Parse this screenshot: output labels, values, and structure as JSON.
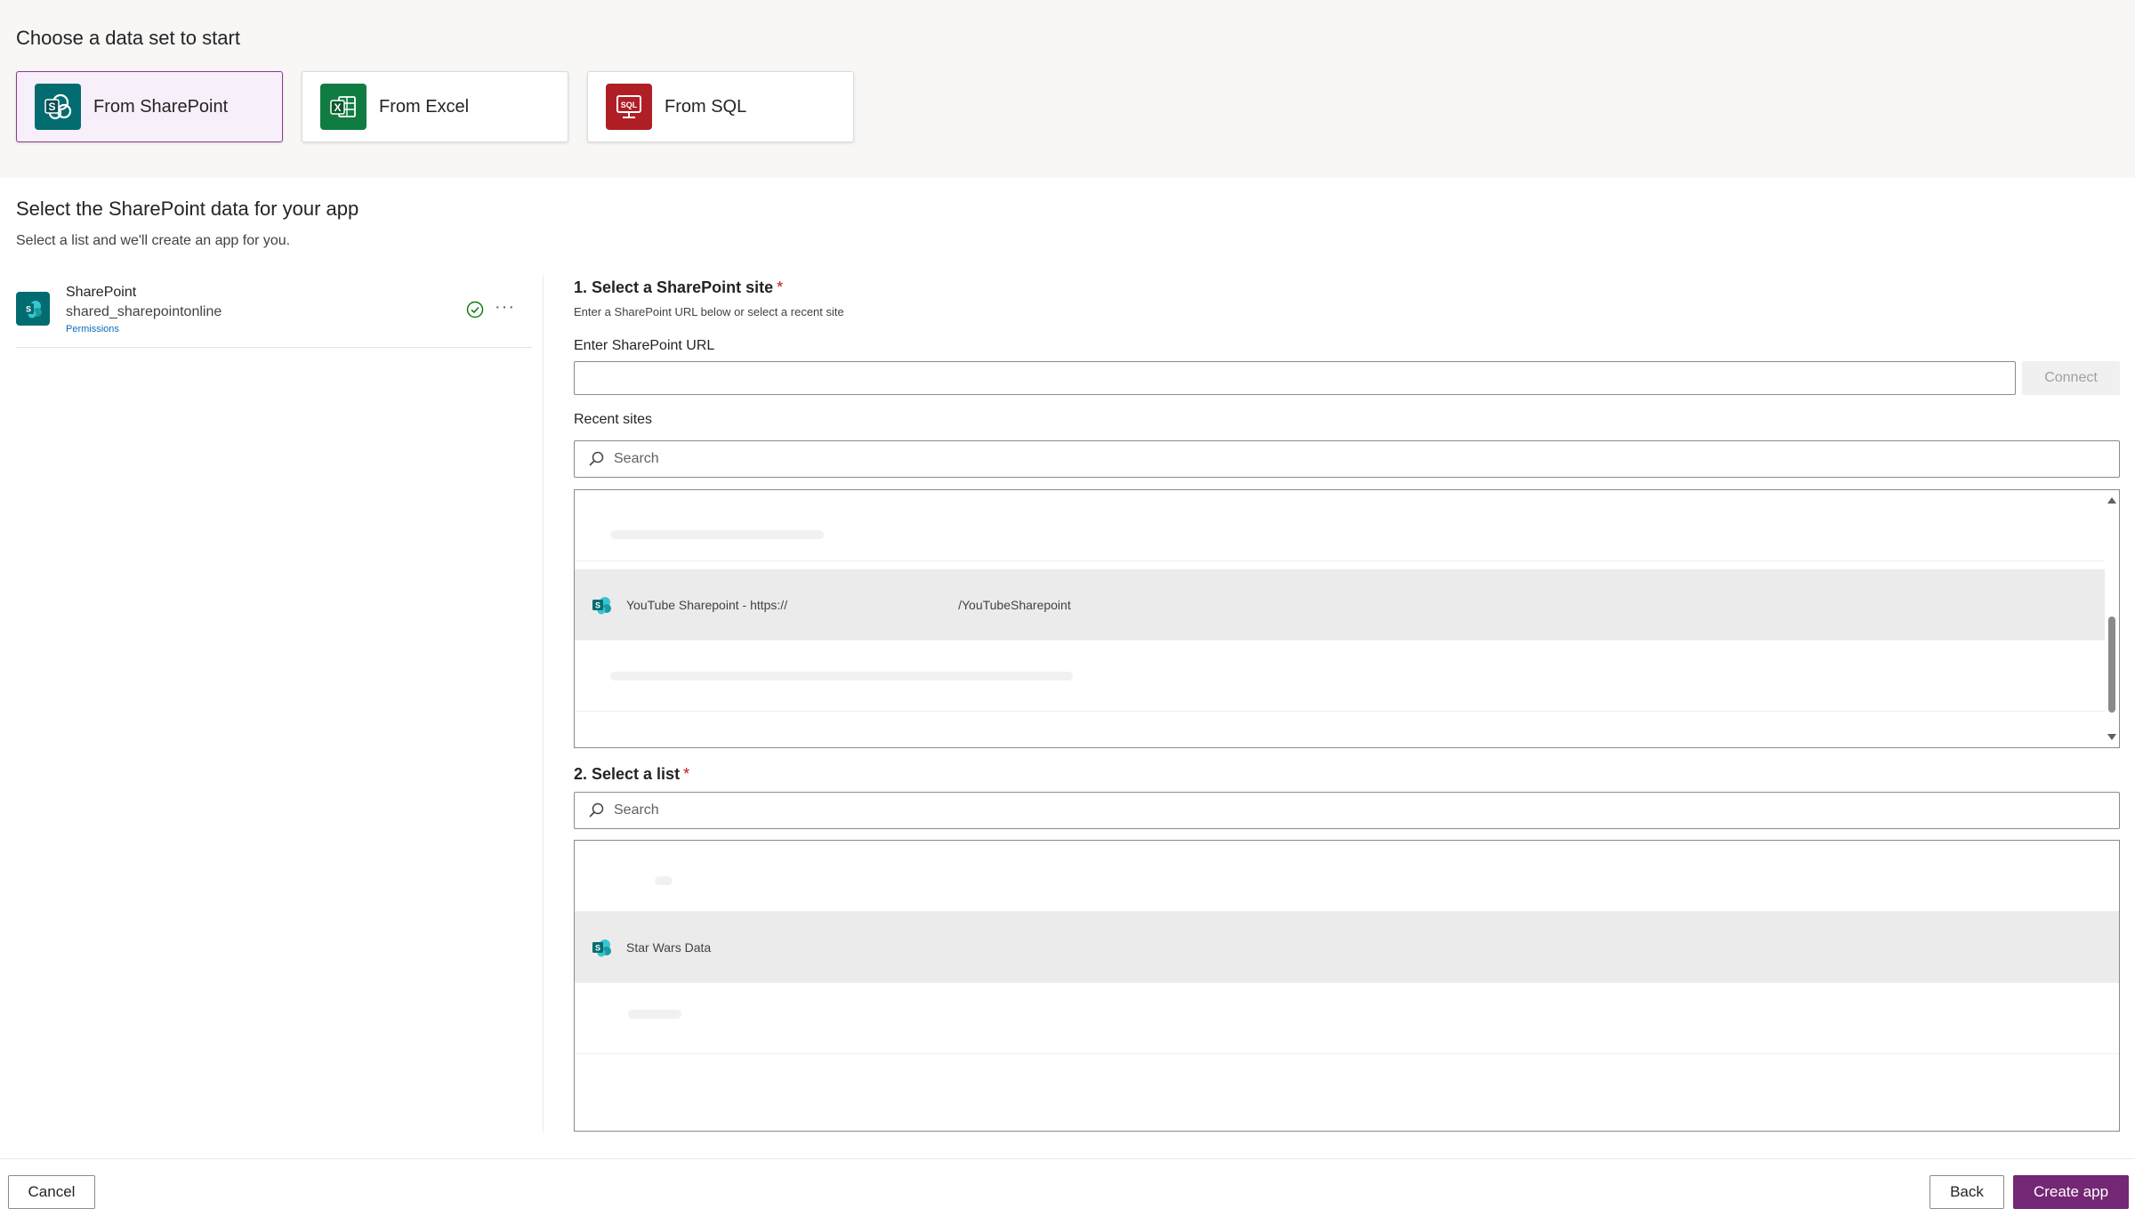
{
  "header": {
    "title": "Choose a data set to start"
  },
  "sources": [
    {
      "label": "From SharePoint",
      "icon": "sharepoint-icon",
      "color": "#036c70",
      "selected": true
    },
    {
      "label": "From Excel",
      "icon": "excel-icon",
      "color": "#107c41",
      "selected": false
    },
    {
      "label": "From SQL",
      "icon": "sql-icon",
      "color": "#b01e26",
      "selected": false
    }
  ],
  "sharepoint": {
    "title": "Select the SharePoint data for your app",
    "subtitle": "Select a list and we'll create an app for you.",
    "connection": {
      "name": "SharePoint",
      "id": "shared_sharepointonline",
      "permissions_label": "Permissions",
      "more": "···",
      "status_color": "#107c10"
    },
    "site": {
      "title": "1. Select a SharePoint site",
      "required_mark": "*",
      "hint": "Enter a SharePoint URL below or select a recent site",
      "url_label": "Enter SharePoint URL",
      "url_value": "",
      "connect_label": "Connect",
      "recent_label": "Recent sites",
      "search_placeholder": "Search",
      "recent_items": [
        {
          "text_start": "YouTube Sharepoint - https://",
          "text_end": "/YouTubeSharepoint"
        }
      ]
    },
    "list": {
      "title": "2. Select a list",
      "required_mark": "*",
      "search_placeholder": "Search",
      "items": [
        {
          "text": "Star Wars Data"
        }
      ]
    }
  },
  "footer": {
    "cancel": "Cancel",
    "back": "Back",
    "create": "Create app"
  },
  "colors": {
    "accent": "#742774",
    "selected_card_bg": "#f7eff9",
    "selected_card_border": "#8b3a8f"
  }
}
